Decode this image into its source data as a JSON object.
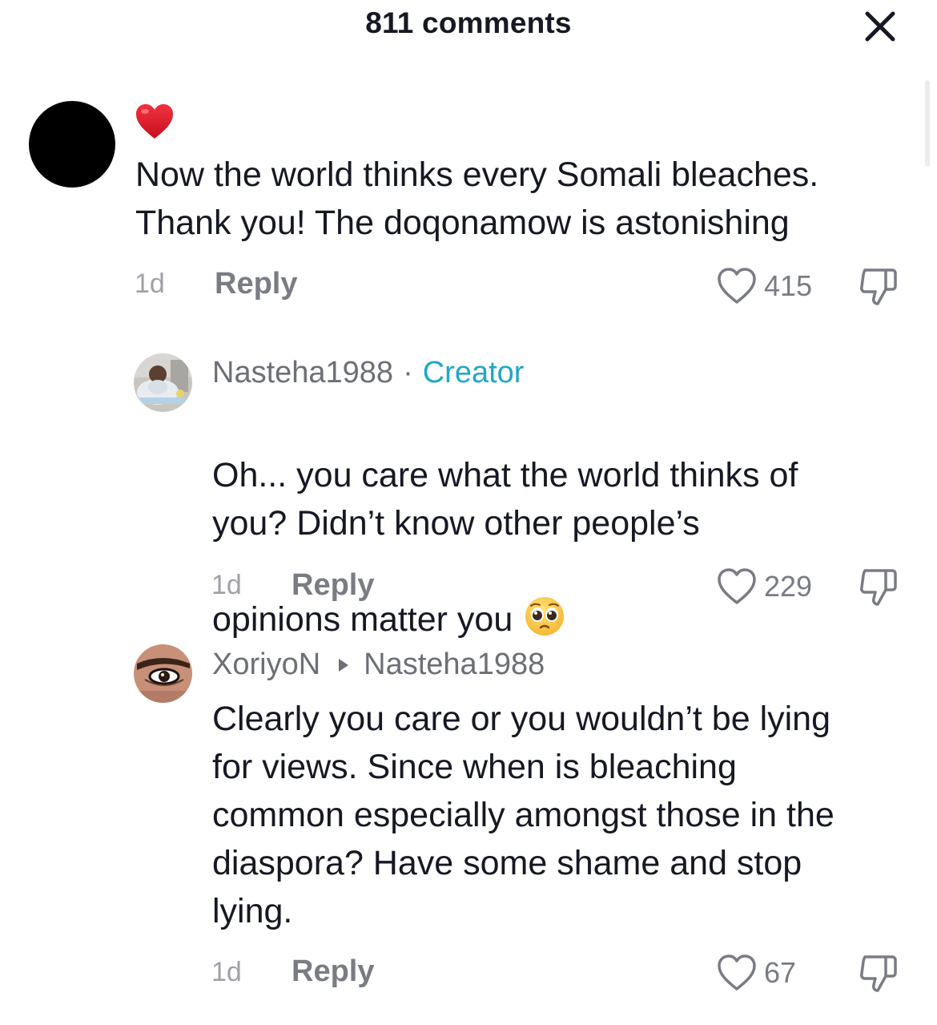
{
  "header": {
    "title": "811 comments"
  },
  "comments": [
    {
      "author": "",
      "avatar": "black-circle",
      "emoji_line": "heart-emoji",
      "body": "Now the world thinks every Somali bleaches.\nThank you! The doqonamow is astonishing",
      "time": "1d",
      "reply_label": "Reply",
      "likes": "415"
    },
    {
      "author": "Nasteha1988",
      "separator": "·",
      "badge": "Creator",
      "avatar": "baby-photo",
      "body": "Oh... you care what the world thinks of\nyou? Didn’t know other people’s\nopinions matter you",
      "trailing_emoji": "pleading-face-emoji",
      "time": "1d",
      "reply_label": "Reply",
      "likes": "229"
    },
    {
      "author": "XoriyoN",
      "reply_to": "Nasteha1988",
      "avatar": "eye-makeup-photo",
      "body": "Clearly you care or you wouldn’t be lying\nfor views. Since when is bleaching\ncommon especially amongst those in the\ndiaspora? Have some shame and stop\nlying.",
      "time": "1d",
      "reply_label": "Reply",
      "likes": "67"
    }
  ],
  "colors": {
    "text": "#161823",
    "secondary": "#6d6f77",
    "muted": "#a0a1a7",
    "creator_accent": "#20a7c9"
  }
}
